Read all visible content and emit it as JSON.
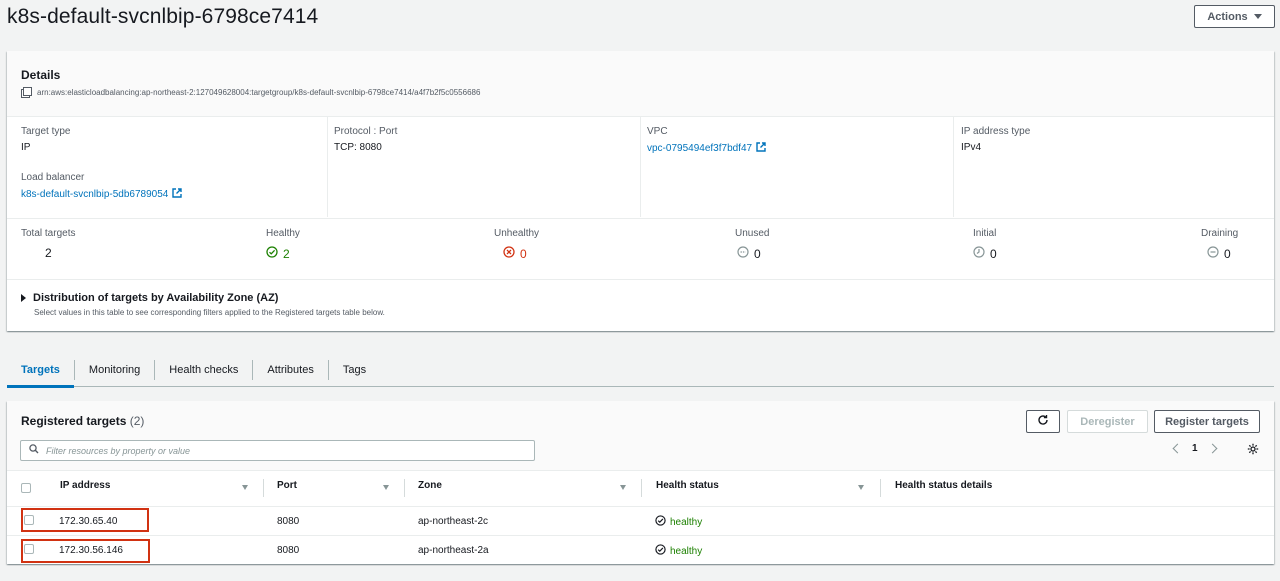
{
  "page": {
    "title": "k8s-default-svcnlbip-6798ce7414",
    "actions_label": "Actions"
  },
  "details": {
    "title": "Details",
    "arn": "arn:aws:elasticloadbalancing:ap-northeast-2:127049628004:targetgroup/k8s-default-svcnlbip-6798ce7414/a4f7b2f5c0556686",
    "target_type": {
      "label": "Target type",
      "value": "IP"
    },
    "protocol_port": {
      "label": "Protocol : Port",
      "value": "TCP: 8080"
    },
    "vpc": {
      "label": "VPC",
      "value": "vpc-0795494ef3f7bdf47"
    },
    "ip_type": {
      "label": "IP address type",
      "value": "IPv4"
    },
    "load_balancer": {
      "label": "Load balancer",
      "value": "k8s-default-svcnlbip-5db6789054"
    },
    "counts": {
      "total": {
        "label": "Total targets",
        "value": "2"
      },
      "healthy": {
        "label": "Healthy",
        "value": "2"
      },
      "unhealthy": {
        "label": "Unhealthy",
        "value": "0"
      },
      "unused": {
        "label": "Unused",
        "value": "0"
      },
      "initial": {
        "label": "Initial",
        "value": "0"
      },
      "draining": {
        "label": "Draining",
        "value": "0"
      }
    },
    "distribution": {
      "title": "Distribution of targets by Availability Zone (AZ)",
      "description": "Select values in this table to see corresponding filters applied to the Registered targets table below."
    }
  },
  "tabs": [
    {
      "label": "Targets",
      "active": true
    },
    {
      "label": "Monitoring"
    },
    {
      "label": "Health checks"
    },
    {
      "label": "Attributes"
    },
    {
      "label": "Tags"
    }
  ],
  "registered": {
    "title": "Registered targets",
    "count": "(2)",
    "deregister_label": "Deregister",
    "register_label": "Register targets",
    "search_placeholder": "Filter resources by property or value",
    "page_number": "1",
    "columns": [
      "IP address",
      "Port",
      "Zone",
      "Health status",
      "Health status details"
    ],
    "rows": [
      {
        "ip": "172.30.65.40",
        "port": "8080",
        "zone": "ap-northeast-2c",
        "health": "healthy",
        "details": ""
      },
      {
        "ip": "172.30.56.146",
        "port": "8080",
        "zone": "ap-northeast-2a",
        "health": "healthy",
        "details": ""
      }
    ]
  },
  "colors": {
    "link": "#0073bb",
    "healthy": "#1d8102",
    "unhealthy": "#d13212",
    "highlight": "#d13212"
  }
}
